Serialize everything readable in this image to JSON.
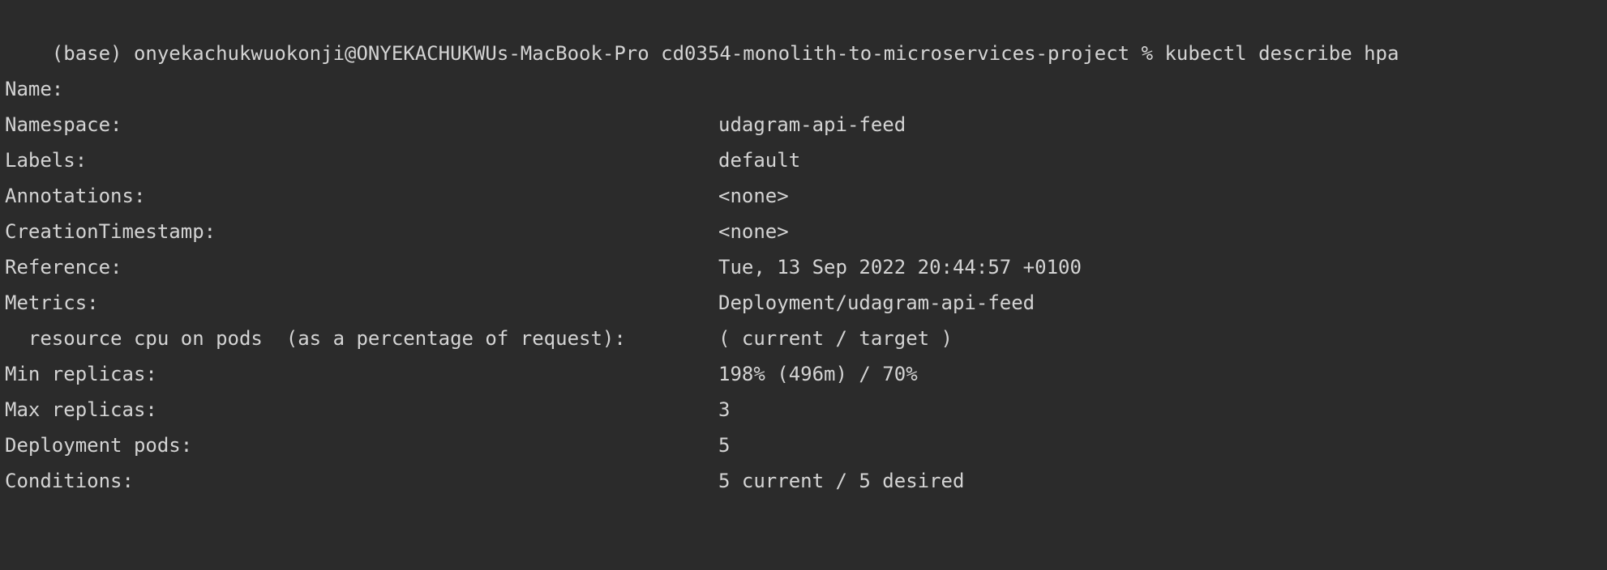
{
  "prompt": {
    "text": "(base) onyekachukwuokonji@ONYEKACHUKWUs-MacBook-Pro cd0354-monolith-to-microservices-project % kubectl describe hpa"
  },
  "rows": [
    {
      "label": "Name:",
      "value": "udagram-api-feed"
    },
    {
      "label": "Namespace:",
      "value": "default"
    },
    {
      "label": "Labels:",
      "value": "<none>"
    },
    {
      "label": "Annotations:",
      "value": "<none>"
    },
    {
      "label": "CreationTimestamp:",
      "value": "Tue, 13 Sep 2022 20:44:57 +0100"
    },
    {
      "label": "Reference:",
      "value": "Deployment/udagram-api-feed"
    },
    {
      "label": "Metrics:",
      "value": "( current / target )"
    },
    {
      "label": "  resource cpu on pods  (as a percentage of request):",
      "value": "198% (496m) / 70%"
    },
    {
      "label": "Min replicas:",
      "value": "3"
    },
    {
      "label": "Max replicas:",
      "value": "5"
    },
    {
      "label": "Deployment pods:",
      "value": "5 current / 5 desired"
    },
    {
      "label": "Conditions:",
      "value": ""
    }
  ]
}
